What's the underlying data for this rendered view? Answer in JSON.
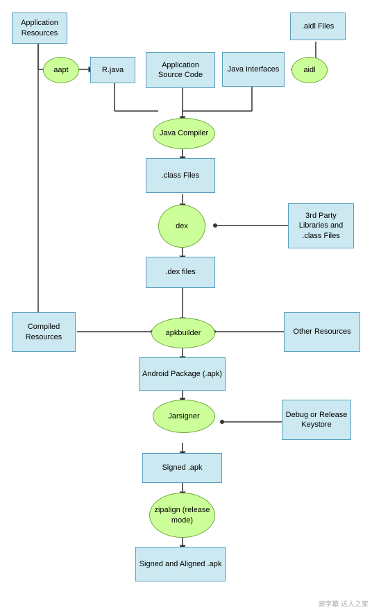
{
  "nodes": {
    "app_resources": {
      "label": "Application\nResources"
    },
    "aidl_files": {
      "label": ".aidl Files"
    },
    "aapt": {
      "label": "aapt"
    },
    "r_java": {
      "label": "R.java"
    },
    "app_source": {
      "label": "Application\nSource Code"
    },
    "java_interfaces": {
      "label": "Java\nInterfaces"
    },
    "aidl": {
      "label": "aidl"
    },
    "java_compiler": {
      "label": "Java\nCompiler"
    },
    "class_files": {
      "label": ".class Files"
    },
    "dex": {
      "label": "dex"
    },
    "third_party": {
      "label": "3rd Party\nLibraries\nand .class\nFiles"
    },
    "dex_files": {
      "label": ".dex files"
    },
    "compiled_resources": {
      "label": "Compiled\nResources"
    },
    "apkbuilder": {
      "label": "apkbuilder"
    },
    "other_resources": {
      "label": "Other Resources"
    },
    "android_package": {
      "label": "Android Package\n(.apk)"
    },
    "jarsigner": {
      "label": "Jarsigner"
    },
    "debug_release": {
      "label": "Debug or\nRelease\nKeystore"
    },
    "signed_apk": {
      "label": "Signed .apk"
    },
    "zipalign": {
      "label": "zipalign\n(release\nmode)"
    },
    "signed_aligned": {
      "label": "Signed and\nAligned .apk"
    }
  }
}
